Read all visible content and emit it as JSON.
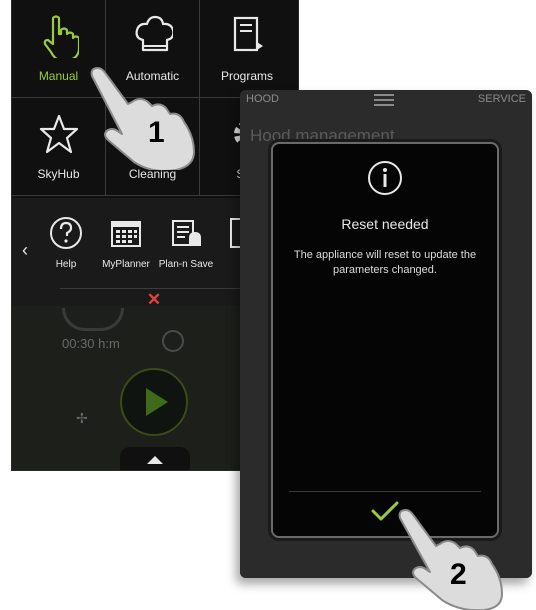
{
  "left_screen": {
    "tiles": [
      {
        "label": "Manual",
        "icon": "hand-pointer-icon"
      },
      {
        "label": "Automatic",
        "icon": "chef-hat-icon"
      },
      {
        "label": "Programs",
        "icon": "book-icon"
      },
      {
        "label": "SkyHub",
        "icon": "star-icon"
      },
      {
        "label": "Cleaning",
        "icon": "sparkle-icon"
      },
      {
        "label": "Sett",
        "icon": "gear-icon"
      }
    ],
    "toolbar": {
      "items": [
        {
          "label": "Help",
          "icon": "question-icon"
        },
        {
          "label": "MyPlanner",
          "icon": "calendar-icon"
        },
        {
          "label": "Plan-n Save",
          "icon": "planner-icon"
        }
      ],
      "close_glyph": "✕",
      "prev_glyph": "‹"
    },
    "ghost_timer": "00:30 h:m",
    "step_number": "1"
  },
  "right_screen": {
    "tab_left": "HOOD",
    "tab_right": "SERVICE",
    "title": "Hood management",
    "dialog": {
      "icon": "info-icon",
      "title": "Reset needed",
      "message": "The appliance will reset to update the parameters changed.",
      "confirm_icon": "check-icon"
    },
    "step_number": "2"
  },
  "colors": {
    "accent_green": "#9ccb3a",
    "close_red": "#e8403a"
  }
}
